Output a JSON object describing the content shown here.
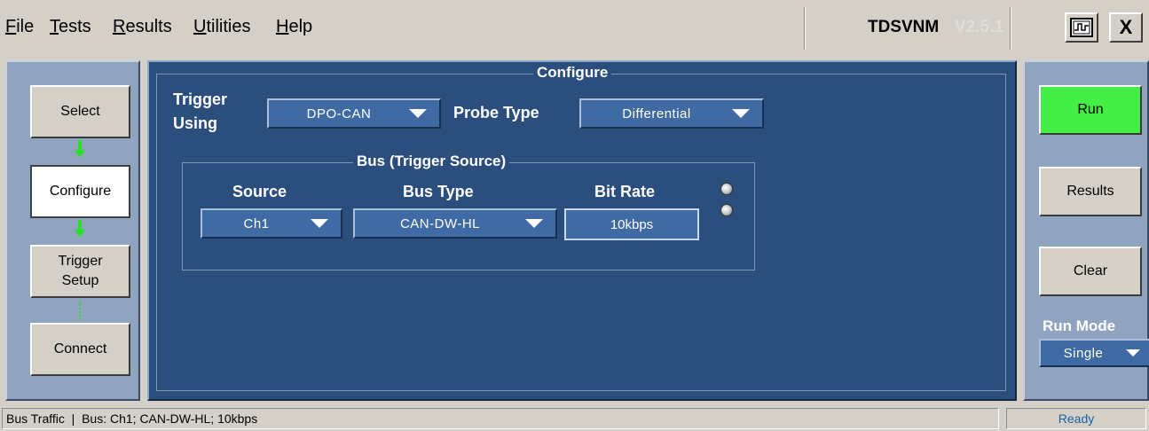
{
  "menu": {
    "items": [
      {
        "accel": "F",
        "rest": "ile"
      },
      {
        "accel": "T",
        "rest": "ests"
      },
      {
        "accel": "R",
        "rest": "esults"
      },
      {
        "accel": "U",
        "rest": "tilities"
      },
      {
        "accel": "H",
        "rest": "elp"
      }
    ]
  },
  "app": {
    "title": "TDSVNM",
    "version": "V2.5.1"
  },
  "window_controls": {
    "close_label": "X"
  },
  "nav": {
    "select": "Select",
    "configure": "Configure",
    "trigger_setup_line1": "Trigger",
    "trigger_setup_line2": "Setup",
    "connect": "Connect"
  },
  "configure": {
    "title": "Configure",
    "trigger_using_label_1": "Trigger",
    "trigger_using_label_2": "Using",
    "trigger_using_value": "DPO-CAN",
    "probe_type_label": "Probe Type",
    "probe_type_value": "Differential",
    "bus": {
      "title": "Bus (Trigger Source)",
      "source_label": "Source",
      "source_value": "Ch1",
      "bus_type_label": "Bus Type",
      "bus_type_value": "CAN-DW-HL",
      "bit_rate_label": "Bit Rate",
      "bit_rate_value": "10kbps"
    }
  },
  "actions": {
    "run": "Run",
    "results": "Results",
    "clear": "Clear",
    "run_mode_label": "Run Mode",
    "run_mode_value": "Single"
  },
  "status": {
    "left": "Bus Traffic  |  Bus: Ch1; CAN-DW-HL; 10kbps",
    "right": "Ready"
  },
  "colors": {
    "panel_blue": "#2b4e7c",
    "nav_gray_blue": "#90a4bf",
    "run_green": "#44ee44",
    "arrow_green": "#2be02b",
    "status_ready": "#1f5fa8"
  }
}
